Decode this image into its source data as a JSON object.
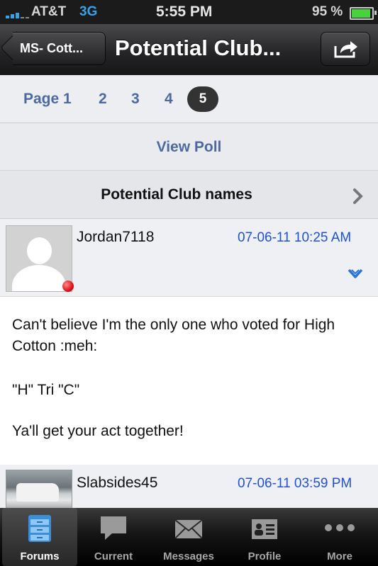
{
  "status_bar": {
    "carrier": "AT&T",
    "network": "3G",
    "time": "5:55 PM",
    "battery": "95 %",
    "battery_level": 0.95
  },
  "nav": {
    "back_label": "MS- Cott...",
    "title": "Potential Club...",
    "share_icon": "share-icon"
  },
  "pager": {
    "page_label": "Page 1",
    "pages": [
      "2",
      "3",
      "4"
    ],
    "current": "5"
  },
  "poll": {
    "label": "View Poll"
  },
  "thread": {
    "title": "Potential Club names"
  },
  "posts": [
    {
      "username": "Jordan7118",
      "date": "07-06-11 10:25 AM",
      "body": [
        "Can't believe I'm the only one who voted for High Cotton :meh:",
        "\"H\" Tri \"C\"",
        "Ya'll get your act together!"
      ]
    },
    {
      "username": "Slabsides45",
      "date": "07-06-11 03:59 PM"
    }
  ],
  "tabs": [
    {
      "label": "Forums",
      "icon": "forums-icon",
      "active": true
    },
    {
      "label": "Current",
      "icon": "speech-bubble-icon"
    },
    {
      "label": "Messages",
      "icon": "envelope-icon"
    },
    {
      "label": "Profile",
      "icon": "profile-card-icon"
    },
    {
      "label": "More",
      "icon": "more-dots-icon"
    }
  ],
  "colors": {
    "link": "#4d6aa0",
    "date": "#2150d8",
    "accent_blue": "#3aa0e8"
  }
}
